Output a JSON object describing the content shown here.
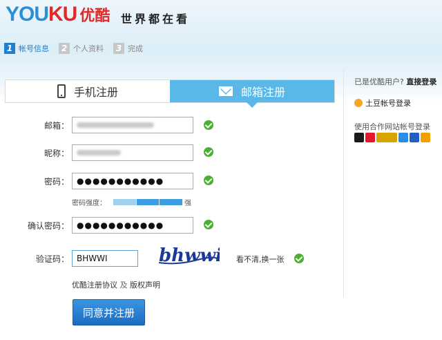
{
  "header": {
    "logo_en_part1": "YOU",
    "logo_en_part2": "KU",
    "logo_cn": "优酷",
    "slogan": "世界都在看"
  },
  "steps": [
    {
      "num": "1",
      "label": "帐号信息",
      "active": true
    },
    {
      "num": "2",
      "label": "个人资料",
      "active": false
    },
    {
      "num": "3",
      "label": "完成",
      "active": false
    }
  ],
  "tabs": [
    {
      "label": "手机注册",
      "icon": "phone-icon",
      "active": false
    },
    {
      "label": "邮箱注册",
      "icon": "mail-icon",
      "active": true
    }
  ],
  "form": {
    "email_label": "邮箱：",
    "nickname_label": "昵称：",
    "password_label": "密码：",
    "password_value": "●●●●●●●●●●●",
    "strength_label": "密码强度：",
    "strength_text": "强",
    "strength_level": 0.85,
    "confirm_label": "确认密码：",
    "confirm_value": "●●●●●●●●●●●",
    "captcha_label": "验证码：",
    "captcha_value": "BHWWI",
    "captcha_image_text": "bhwwi",
    "refresh_text": "看不清,换一张",
    "agreement_link": "优酷注册协议",
    "agreement_and": "及",
    "copyright_link": "版权声明",
    "submit_label": "同意并注册"
  },
  "side": {
    "already_user": "已是优酷用户?",
    "direct_login": "直接登录",
    "tudou_login": "土豆帐号登录",
    "partner_login": "使用合作网站帐号登录",
    "partners": [
      "qq-icon",
      "weibo-icon",
      "alipay-icon",
      "qzone-icon",
      "renren-icon",
      "kaixin-icon"
    ]
  },
  "colors": {
    "brand_blue": "#1f7fcf",
    "brand_red": "#e02a2a",
    "tab_active": "#5ab8e8",
    "ok_green": "#4caf30"
  }
}
